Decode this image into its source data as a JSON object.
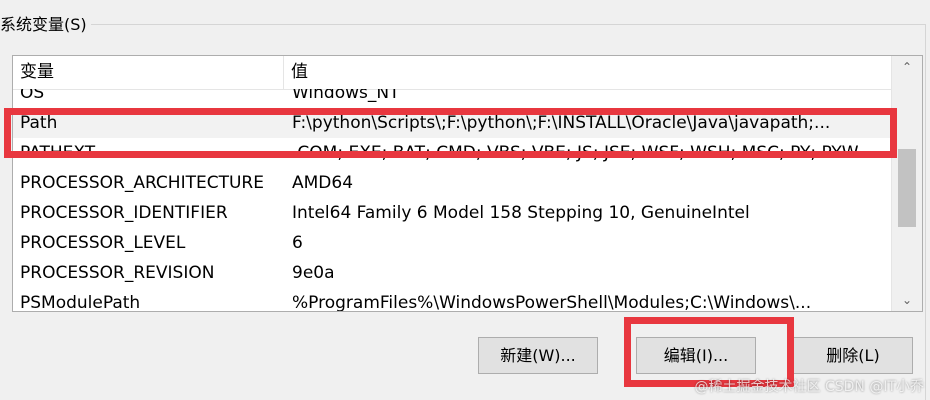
{
  "group": {
    "title": "系统变量(S)"
  },
  "table": {
    "columns": [
      "变量",
      "值"
    ],
    "rows": [
      {
        "name": "OS",
        "value": "Windows_NT"
      },
      {
        "name": "Path",
        "value": "F:\\python\\Scripts\\;F:\\python\\;F:\\INSTALL\\Oracle\\Java\\javapath;..."
      },
      {
        "name": "PATHEXT",
        "value": ".COM;.EXE;.BAT;.CMD;.VBS;.VBE;.JS;.JSE;.WSF;.WSH;.MSC;.PY;.PYW"
      },
      {
        "name": "PROCESSOR_ARCHITECTURE",
        "value": "AMD64"
      },
      {
        "name": "PROCESSOR_IDENTIFIER",
        "value": "Intel64 Family 6 Model 158 Stepping 10, GenuineIntel"
      },
      {
        "name": "PROCESSOR_LEVEL",
        "value": "6"
      },
      {
        "name": "PROCESSOR_REVISION",
        "value": "9e0a"
      },
      {
        "name": "PSModulePath",
        "value": "%ProgramFiles%\\WindowsPowerShell\\Modules;C:\\Windows\\..."
      }
    ]
  },
  "buttons": {
    "new": "新建(W)...",
    "edit": "编辑(I)...",
    "delete": "删除(L)"
  },
  "scrollbar": {
    "up_icon": "chevron-up-icon",
    "down_icon": "chevron-down-icon"
  },
  "highlight_color": "#e8373f",
  "watermark": "@稀土掘金技术社区 CSDN @IT小乔"
}
